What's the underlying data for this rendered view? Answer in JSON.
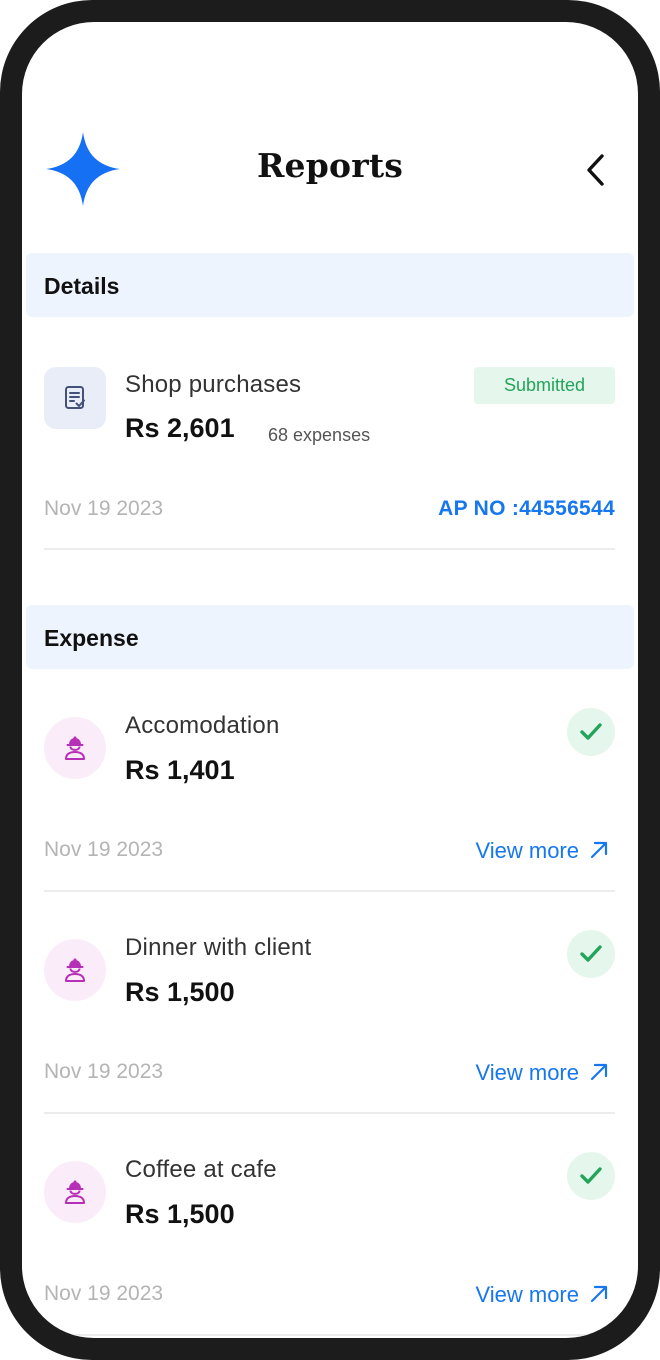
{
  "header": {
    "title": "Reports",
    "logo_icon": "sparkle-star-icon",
    "back_icon": "chevron-left-icon",
    "accent_color": "#1677ee"
  },
  "details": {
    "section_label": "Details",
    "report": {
      "icon": "clipboard-check-icon",
      "title": "Shop purchases",
      "amount": "Rs 2,601",
      "expense_count": "68 expenses",
      "status": "Submitted",
      "date": "Nov 19 2023",
      "ap_number": "AP NO :44556544"
    }
  },
  "expense": {
    "section_label": "Expense",
    "items": [
      {
        "icon": "worker-icon",
        "title": "Accomodation",
        "amount": "Rs 1,401",
        "date": "Nov 19 2023",
        "status_icon": "check-icon",
        "link_label": "View more"
      },
      {
        "icon": "worker-icon",
        "title": "Dinner with client",
        "amount": "Rs 1,500",
        "date": "Nov 19 2023",
        "status_icon": "check-icon",
        "link_label": "View more"
      },
      {
        "icon": "worker-icon",
        "title": "Coffee at cafe",
        "amount": "Rs 1,500",
        "date": "Nov 19 2023",
        "status_icon": "check-icon",
        "link_label": "View more"
      }
    ]
  }
}
